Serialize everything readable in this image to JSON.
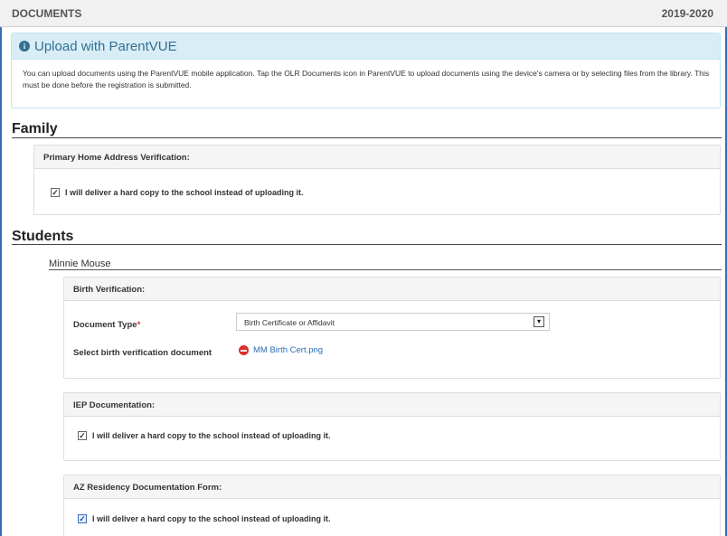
{
  "header": {
    "title": "DOCUMENTS",
    "year": "2019-2020"
  },
  "alert": {
    "icon": "info-circle-icon",
    "title": "Upload with ParentVUE",
    "body": "You can upload documents using the ParentVUE mobile application. Tap the OLR Documents icon in ParentVUE to upload documents using the device's camera or by selecting files from the library. This must be done before the registration is submitted."
  },
  "family": {
    "heading": "Family",
    "home_address": {
      "title": "Primary Home Address Verification:",
      "hardcopy_label": "I will deliver a hard copy to the school instead of uploading it.",
      "checked": true
    }
  },
  "students": {
    "heading": "Students",
    "student_name": "Minnie Mouse",
    "birth": {
      "title": "Birth Verification:",
      "doc_type_label": "Document Type",
      "required_mark": "*",
      "doc_type_value": "Birth Certificate or Affidavit",
      "select_label": "Select birth verification document",
      "file_name": "MM Birth Cert.png"
    },
    "iep": {
      "title": "IEP Documentation:",
      "hardcopy_label": "I will deliver a hard copy to the school instead of uploading it.",
      "checked": true
    },
    "az_residency": {
      "title": "AZ Residency Documentation Form:",
      "hardcopy_label": "I will deliver a hard copy to the school instead of uploading it.",
      "checked": true
    }
  }
}
